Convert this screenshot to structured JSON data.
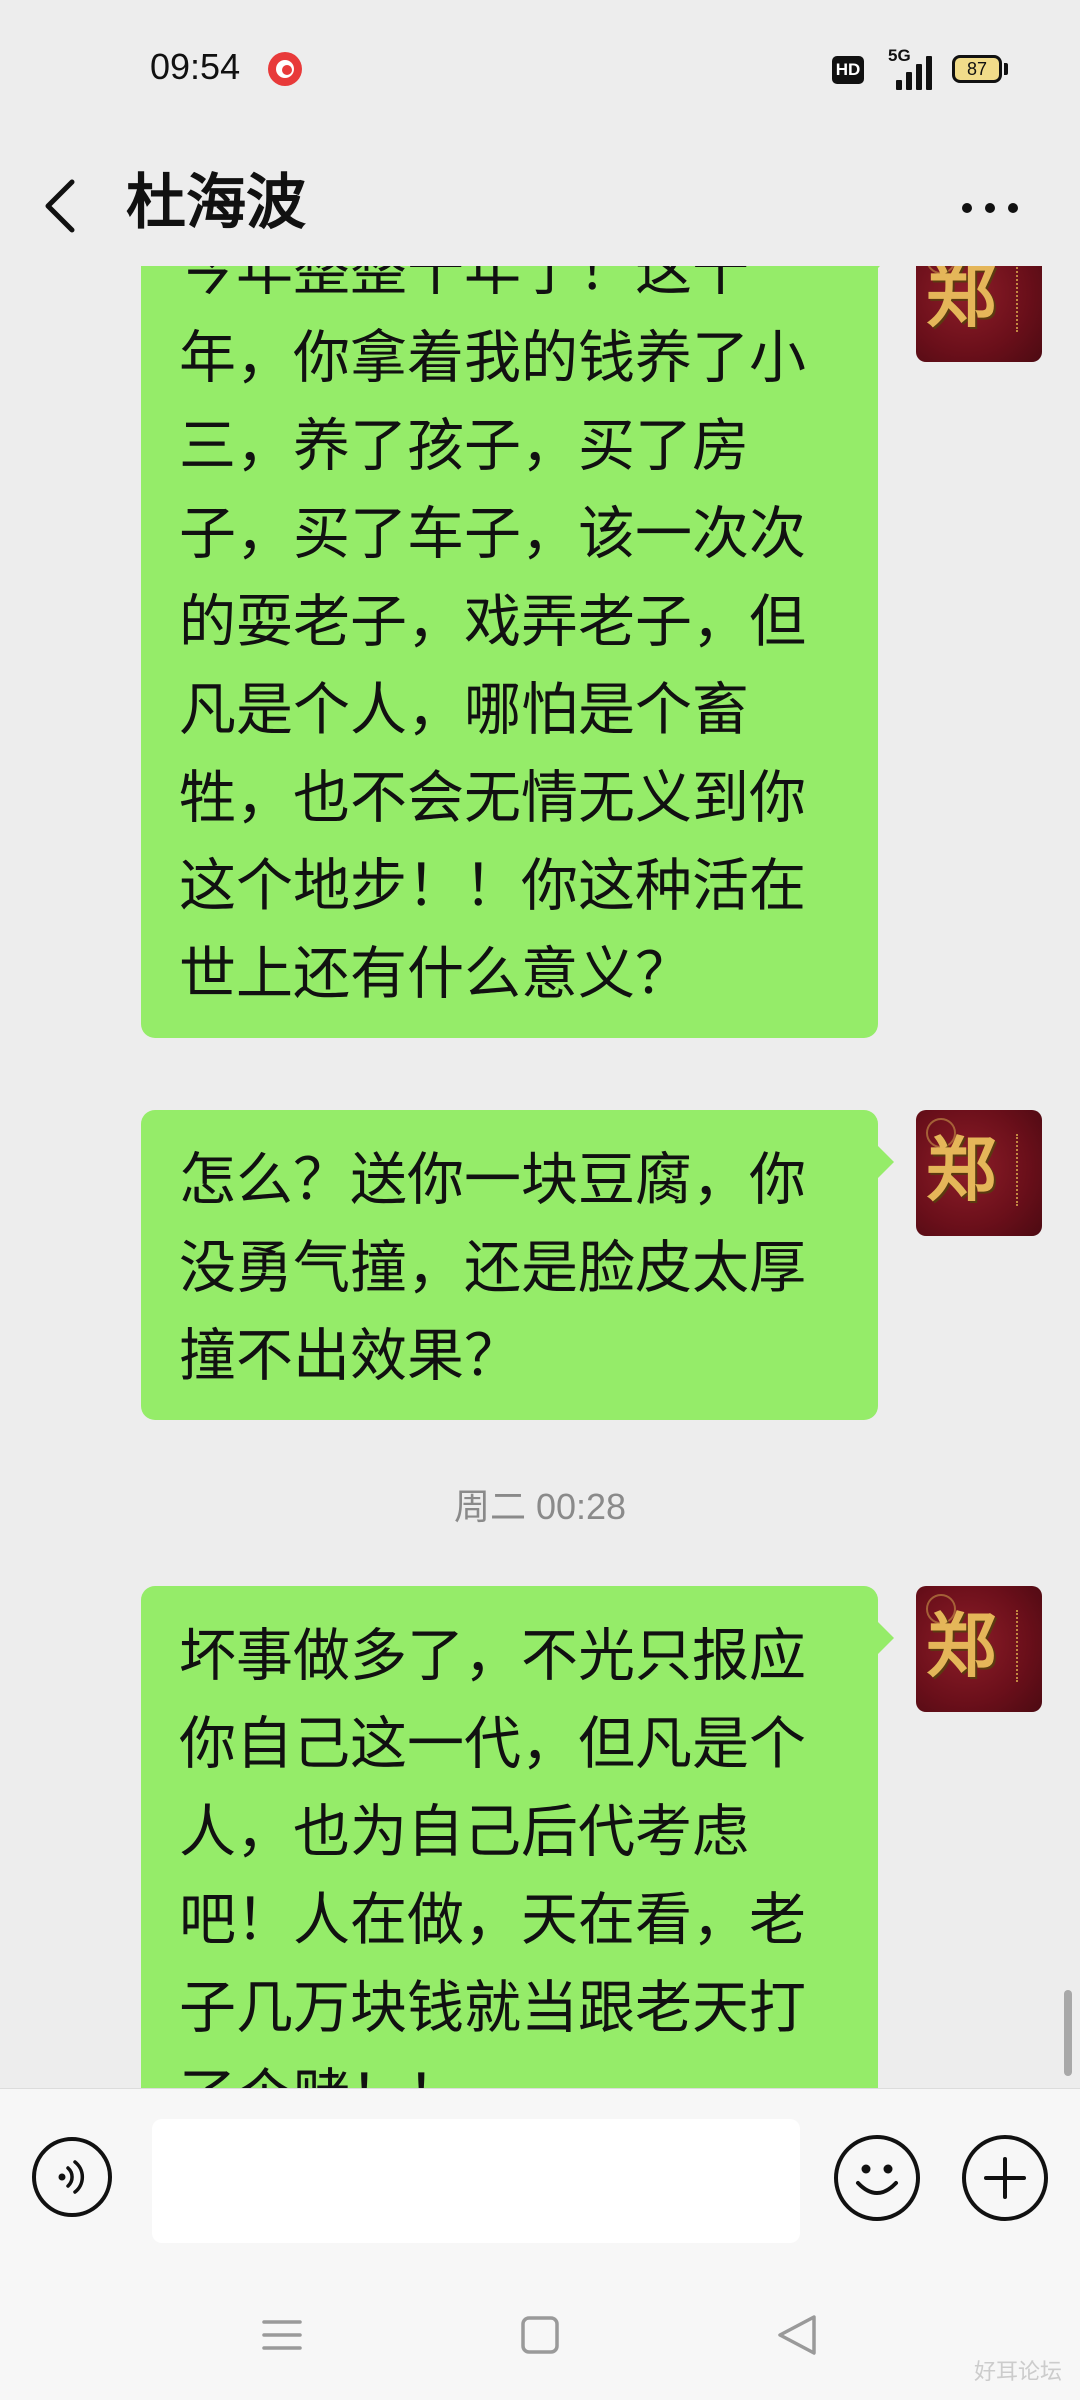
{
  "status_bar": {
    "time": "09:54",
    "app_notification_icon": "red-bird-app-icon",
    "hd_label": "HD",
    "network_label": "5G",
    "battery_level": "87"
  },
  "header": {
    "back_icon": "chevron-left-icon",
    "title": "杜海波",
    "more_icon": "more-dots-icon"
  },
  "messages": [
    {
      "sender": "self",
      "avatar_text": "郑",
      "text": "今年整整十年了！这十年，你拿着我的钱养了小三，养了孩子，买了房子，买了车子，该一次次的耍老子，戏弄老子，但凡是个人，哪怕是个畜牲，也不会无情无义到你这个地步！！你这种活在世上还有什么意义？"
    },
    {
      "sender": "self",
      "avatar_text": "郑",
      "text": "怎么？送你一块豆腐，你没勇气撞，还是脸皮太厚撞不出效果？"
    },
    {
      "sender": "self",
      "avatar_text": "郑",
      "text": "坏事做多了，不光只报应你自己这一代，但凡是个人，也为自己后代考虑吧！人在做，天在看，老子几万块钱就当跟老天打了个赌！！"
    }
  ],
  "timestamp": "周二 00:28",
  "input_bar": {
    "voice_icon": "voice-icon",
    "input_value": "",
    "emoji_icon": "emoji-icon",
    "plus_icon": "plus-icon"
  },
  "nav_bar": {
    "menu_icon": "menu-icon",
    "home_icon": "home-square-icon",
    "back_icon": "triangle-back-icon",
    "watermark": "好耳论坛"
  },
  "colors": {
    "bubble_self": "#95ec69",
    "background": "#ededed",
    "input_bar": "#f7f7f7",
    "avatar": "#6a0f1a"
  }
}
